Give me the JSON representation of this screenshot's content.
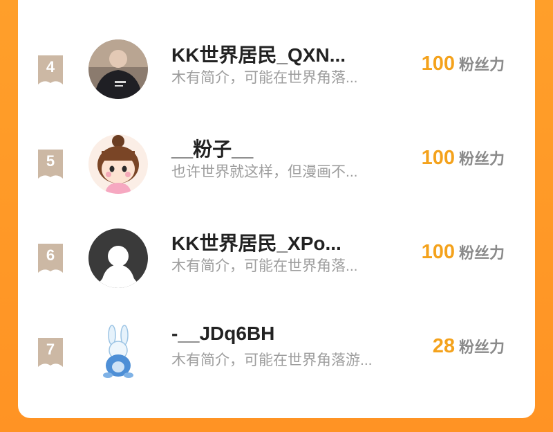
{
  "colors": {
    "background": "#ff9f2a",
    "card": "#ffffff",
    "rank_badge": "#ccb8a4",
    "fan_count": "#f4a21c",
    "name": "#222222",
    "bio": "#9d9d9d"
  },
  "fans_unit": "粉丝力",
  "ranking": [
    {
      "rank": "4",
      "name": "KK世界居民_QXN...",
      "bio": "木有简介，可能在世界角落...",
      "fans": "100",
      "avatar": "photo-avatar-dark-hoodie"
    },
    {
      "rank": "5",
      "name": "__粉子__",
      "bio": "也许世界就这样，但漫画不...",
      "fans": "100",
      "avatar": "cartoon-girl-avatar"
    },
    {
      "rank": "6",
      "name": "KK世界居民_XPo...",
      "bio": "木有简介，可能在世界角落...",
      "fans": "100",
      "avatar": "default-ghost-avatar"
    },
    {
      "rank": "7",
      "name": "-__JDq6BH",
      "bio": "木有简介，可能在世界角落游...",
      "fans": "28",
      "avatar": "bunny-mascot-avatar"
    }
  ]
}
